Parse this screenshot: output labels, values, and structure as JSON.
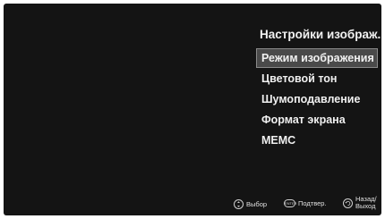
{
  "menu": {
    "title": "Настройки изображ...",
    "items": [
      {
        "label": "Режим изображения",
        "selected": true
      },
      {
        "label": "Цветовой тон",
        "selected": false
      },
      {
        "label": "Шумоподавление",
        "selected": false
      },
      {
        "label": "Формат экрана",
        "selected": false
      },
      {
        "label": "MEMC",
        "selected": false
      }
    ]
  },
  "footer": {
    "select_label": "Выбор",
    "select_icon": "dpad-updown-icon",
    "confirm_label": "Подтвер.",
    "confirm_icon": "enter-icon",
    "confirm_icon_text": "ENTER",
    "back_label_line1": "Назад/",
    "back_label_line2": "Выход",
    "back_icon": "return-icon"
  },
  "colors": {
    "background": "#141414",
    "selected_background": "#4a4a4a",
    "text": "#ffffff"
  }
}
